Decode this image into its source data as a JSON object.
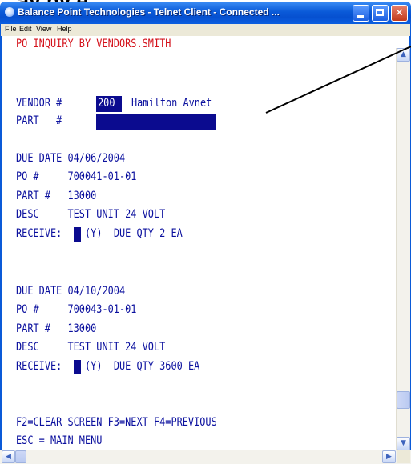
{
  "caption": "...ay by e...",
  "window": {
    "title": "Balance Point Technologies - Telnet Client - Connected ...",
    "menu": [
      "File",
      "Edit",
      "View",
      "Help"
    ],
    "buttons": {
      "minimize": "_",
      "maximize": "□",
      "close": "✕"
    }
  },
  "terminal": {
    "header": "PO INQUIRY BY VENDORS.SMITH",
    "vendor_label": "VENDOR #",
    "vendor_number": "200",
    "vendor_name": "Hamilton Avnet",
    "part_label": "PART   #",
    "part_value": "",
    "records": [
      {
        "due_date_line": "DUE DATE 04/06/2004",
        "po_line": "PO #     700041-01-01",
        "part_line": "PART #   13000",
        "desc_line": "DESC     TEST UNIT 24 VOLT",
        "receive_label": "RECEIVE:",
        "receive_rest": "(Y)  DUE QTY 2 EA"
      },
      {
        "due_date_line": "DUE DATE 04/10/2004",
        "po_line": "PO #     700043-01-01",
        "part_line": "PART #   13000",
        "desc_line": "DESC     TEST UNIT 24 VOLT",
        "receive_label": "RECEIVE:",
        "receive_rest": "(Y)  DUE QTY 3600 EA"
      }
    ],
    "function_keys": "F2=CLEAR SCREEN F3=NEXT F4=PREVIOUS",
    "escape": "ESC = MAIN MENU"
  },
  "scrollbar": {
    "up": "▲",
    "down": "▼",
    "left": "◀",
    "right": "▶"
  },
  "colors": {
    "terminal_text": "#0b109e",
    "header_text": "#d4121b",
    "field_bg": "#0b0b8f",
    "titlebar": "#0a5ad8"
  }
}
